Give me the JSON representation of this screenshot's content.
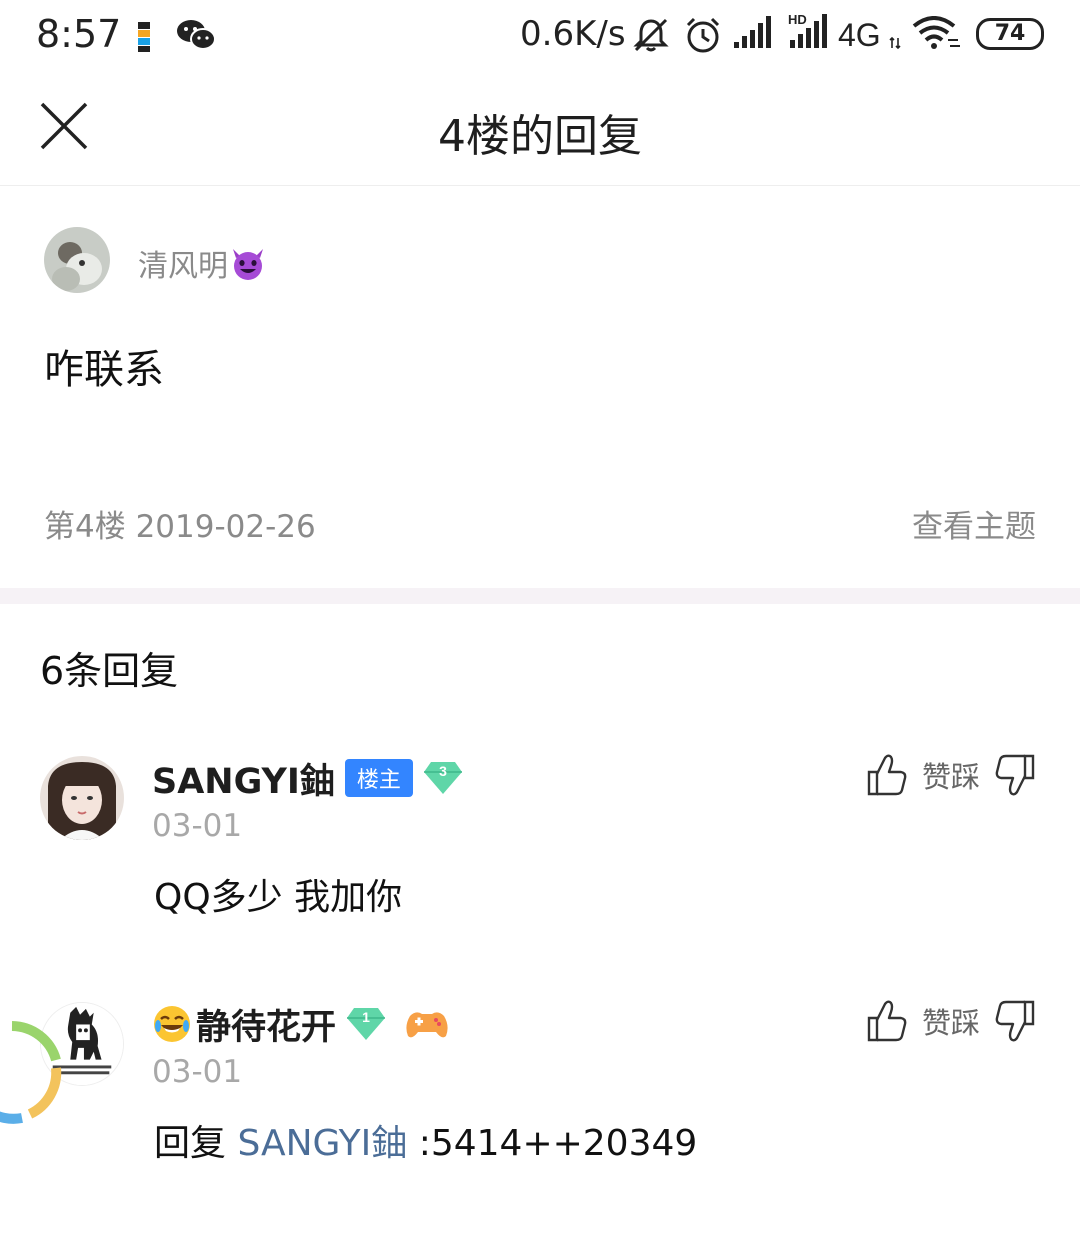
{
  "status_bar": {
    "time": "8:57",
    "net_speed": "0.6K/s",
    "battery": "74"
  },
  "header": {
    "title": "4楼的回复"
  },
  "post": {
    "username": "清风明",
    "body": "咋联系",
    "floor_info": "第4楼  2019-02-26",
    "view_topic_label": "查看主题"
  },
  "replies_header": "6条回复",
  "replies": [
    {
      "username": "SANGYI鈾",
      "owner_badge": "楼主",
      "level": "3",
      "date": "03-01",
      "text": "QQ多少 我加你",
      "vote_label": "赞踩"
    },
    {
      "username": "静待花开",
      "level": "1",
      "date": "03-01",
      "reply_prefix": "回复 ",
      "reply_target": "SANGYI鈾",
      "reply_rest": " :5414++20349",
      "vote_label": "赞踩"
    }
  ],
  "colors": {
    "owner_badge": "#3385ff",
    "link": "#4b6d97",
    "level_gem": "#5fd6a8",
    "meta_text": "#8a8a8a",
    "divider_band": "#f6f2f6"
  },
  "icons": [
    "sim-icon",
    "wechat-icon",
    "mute-icon",
    "alarm-icon",
    "signal-icon",
    "wifi-icon",
    "close-icon",
    "devil-emoji",
    "level-gem-icon",
    "thumb-up-icon",
    "thumb-down-icon",
    "laugh-emoji",
    "gamepad-icon"
  ]
}
